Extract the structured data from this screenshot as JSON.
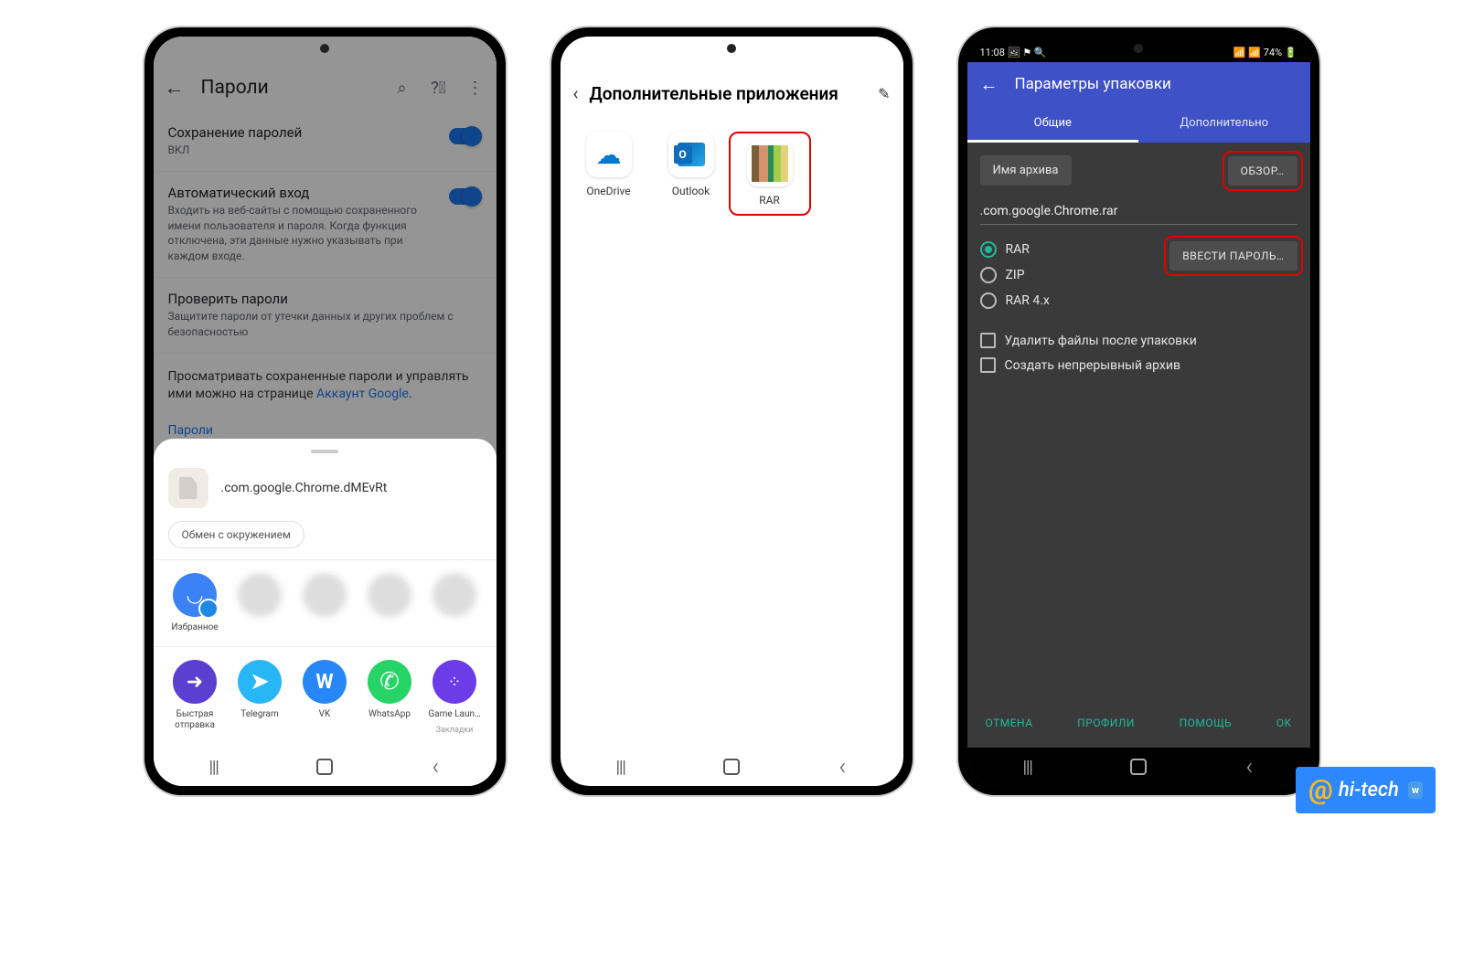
{
  "phone1": {
    "header": {
      "title": "Пароли"
    },
    "save_passwords": {
      "label": "Сохранение паролей",
      "state": "ВКЛ"
    },
    "auto_login": {
      "label": "Автоматический вход",
      "desc": "Входить на веб-сайты с помощью сохраненного имени пользователя и пароля. Когда функция отключена, эти данные нужно указывать при каждом входе."
    },
    "check_passwords": {
      "label": "Проверить пароли",
      "desc": "Защитите пароли от утечки данных и других проблем с безопасностью"
    },
    "view_manage": {
      "prefix": "Просматривать сохраненные пароли и управлять ими можно на странице ",
      "link": "Аккаунт Google",
      "suffix": "."
    },
    "passwords_link": "Пароли",
    "sheet": {
      "filename": ".com.google.Chrome.dMEvRt",
      "nearby": "Обмен с окружением",
      "contacts": [
        {
          "label": "Избранное",
          "name": "bookmark"
        }
      ],
      "apps": [
        {
          "label": "Быстрая отправка",
          "name": "quickshare"
        },
        {
          "label": "Telegram",
          "name": "telegram"
        },
        {
          "label": "VK",
          "name": "vk"
        },
        {
          "label": "WhatsApp",
          "name": "whatsapp"
        },
        {
          "label": "Game Laun…",
          "sub": "Закладки",
          "name": "gamelauncher"
        }
      ]
    }
  },
  "phone2": {
    "title": "Дополнительные приложения",
    "apps": [
      {
        "label": "OneDrive"
      },
      {
        "label": "Outlook"
      },
      {
        "label": "RAR"
      }
    ]
  },
  "phone3": {
    "status": {
      "time": "11:08",
      "battery": "74%"
    },
    "appbar_title": "Параметры упаковки",
    "tabs": {
      "general": "Общие",
      "advanced": "Дополнительно"
    },
    "archive_label": "Имя архива",
    "browse": "ОБЗОР…",
    "archive_name": ".com.google.Chrome.rar",
    "formats": {
      "rar": "RAR",
      "zip": "ZIP",
      "rar4": "RAR 4.x"
    },
    "password_btn": "ВВЕСТИ ПАРОЛЬ…",
    "delete_after": "Удалить файлы после упаковки",
    "solid": "Создать непрерывный архив",
    "footer": {
      "cancel": "ОТМЕНА",
      "profiles": "ПРОФИЛИ",
      "help": "ПОМОЩЬ",
      "ok": "OK"
    }
  },
  "watermark": "hi-tech"
}
